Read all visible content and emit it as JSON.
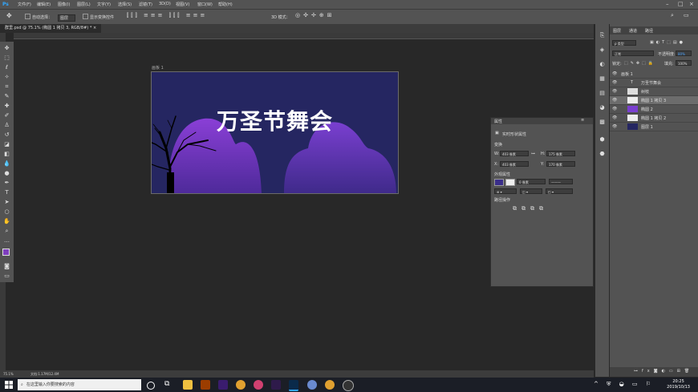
{
  "app": {
    "logo": "Ps"
  },
  "menu": [
    "文件(F)",
    "编辑(E)",
    "图像(I)",
    "图层(L)",
    "文字(Y)",
    "选择(S)",
    "滤镜(T)",
    "3D(D)",
    "视图(V)",
    "窗口(W)",
    "帮助(H)"
  ],
  "options": {
    "auto_select": "自动选择：",
    "layer_select": "图层",
    "show_transform": "显示变换控件",
    "mode_3d": "3D 模式："
  },
  "document": {
    "tab_title": "群里.psd @ 75.1% (椭圆 1 拷贝 3, RGB/8#) *",
    "artboard_label": "画板 1",
    "title_text": "万圣节舞会"
  },
  "status": {
    "zoom": "75.1%",
    "doc": "文档:1.17M/12.4M"
  },
  "properties": {
    "tab": "属性",
    "kind": "实时形状属性",
    "section_transform": "变换",
    "w": "403 像素",
    "h": "175 像素",
    "x": "403 像素",
    "y": "170 像素",
    "section_appearance": "外观属性",
    "stroke_size": "0 像素",
    "section_path_ops": "路径操作"
  },
  "layers_panel": {
    "tabs": [
      "图层",
      "通道",
      "路径"
    ],
    "filter": "ρ 类型",
    "blend": "正常",
    "opacity_label": "不透明度:",
    "opacity": "80%",
    "lock_label": "锁定:",
    "fill_label": "填充:",
    "fill": "100%",
    "layers": [
      {
        "name": "画板 1",
        "type": "group"
      },
      {
        "name": "万圣节舞会",
        "type": "text"
      },
      {
        "name": "树枝",
        "type": "image"
      },
      {
        "name": "椭圆 1 拷贝 3",
        "type": "shape",
        "selected": true
      },
      {
        "name": "椭圆 2",
        "type": "shape"
      },
      {
        "name": "椭圆 1 拷贝 2",
        "type": "shape"
      },
      {
        "name": "图层 1",
        "type": "fill"
      }
    ]
  },
  "taskbar": {
    "search_placeholder": "在这里输入你要搜索的内容",
    "time": "20:25",
    "date": "2019/10/13"
  },
  "colors": {
    "artboard_bg": "#252661",
    "purple": "#7a3fc8",
    "foreground_swatch": "#7f3fbf",
    "ps_blue": "#31a8ff"
  }
}
